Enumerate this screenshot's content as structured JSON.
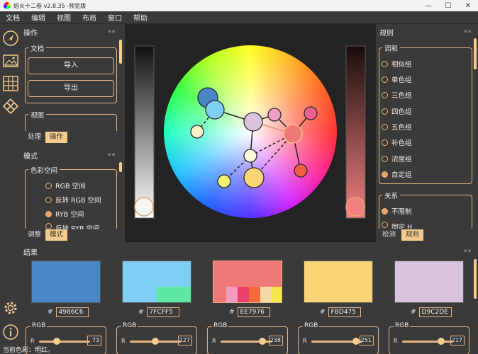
{
  "window": {
    "title": "焰火十二卷 v2.8.35 -预览版",
    "minimize": "—",
    "maximize": "☐",
    "close": "✕"
  },
  "menu": [
    "文档",
    "编辑",
    "视图",
    "布局",
    "窗口",
    "帮助"
  ],
  "left_toolbar": [
    "navigate-icon",
    "image-icon",
    "grid-icon",
    "palette-icon"
  ],
  "left_toolbar_bottom": [
    "settings-icon",
    "info-icon"
  ],
  "operation_panel": {
    "title": "操作",
    "document_group": "文档",
    "import_label": "导入",
    "export_label": "导出",
    "view_group": "视图",
    "tabs": [
      "处理",
      "操作"
    ],
    "active_tab": 1
  },
  "mode_panel": {
    "title": "模式",
    "colorspace_group": "色彩空间",
    "options": [
      "RGB 空间",
      "反转 RGB 空间",
      "RYB 空间",
      "反转 RYB 空间"
    ],
    "selected": 2,
    "tabs": [
      "调整",
      "模式"
    ],
    "active_tab": 1
  },
  "rules_panel": {
    "title": "规则",
    "harmony_group": "调和",
    "harmony_options": [
      "相似组",
      "单色组",
      "三色组",
      "四色组",
      "五色组",
      "补色组",
      "浓度组",
      "自定组"
    ],
    "harmony_selected": 7,
    "relation_group": "关系",
    "relation_options": [
      "不限制",
      "固定 H"
    ],
    "relation_selected": 0,
    "tabs": [
      "检测",
      "规则"
    ],
    "active_tab": 1
  },
  "results": {
    "title": "结果",
    "swatches": [
      {
        "hex": "4986C6",
        "color": "#4986C6",
        "r": 73,
        "accent": null
      },
      {
        "hex": "7FCFF5",
        "color": "#7FCFF5",
        "r": 127,
        "accent": "#5EE8A0"
      },
      {
        "hex": "EE7976",
        "color": "#EE7976",
        "r": 238,
        "accent": "multi"
      },
      {
        "hex": "FBD475",
        "color": "#FBD475",
        "r": 251,
        "accent": null
      },
      {
        "hex": "D9C2DE",
        "color": "#D9C2DE",
        "r": 217,
        "accent": null
      }
    ],
    "rgb_label": "RGB",
    "r_label": "R",
    "multi_colors": [
      "#F29AC0",
      "#EC3F6E",
      "#F56A3A",
      "#F7D8A8",
      "#F2E84A"
    ]
  },
  "status": "当前色彩：明红。",
  "colors": {
    "accent": "#E6B484",
    "tab_active": "#F5CC8E",
    "bg": "#3A3A3A",
    "canvas": "#232323"
  }
}
